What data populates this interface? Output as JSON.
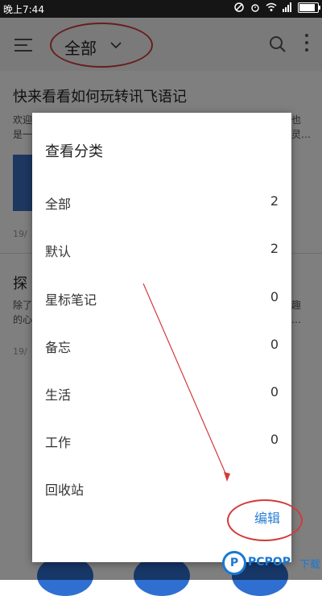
{
  "status_bar": {
    "time": "晚上7:44"
  },
  "header": {
    "title": "全部"
  },
  "notes": [
    {
      "title": "快来看看如何玩转讯飞语记",
      "snippet_left": [
        "欢迎",
        "是一"
      ],
      "snippet_right": [
        "也",
        "灵…"
      ],
      "date": "19/"
    },
    {
      "title": "探",
      "snippet_left": [
        "除了",
        "的心"
      ],
      "snippet_right": [
        "趣",
        "…"
      ],
      "date": "19/"
    }
  ],
  "dialog": {
    "title": "查看分类",
    "categories": [
      {
        "label": "全部",
        "count": "2"
      },
      {
        "label": "默认",
        "count": "2"
      },
      {
        "label": "星标笔记",
        "count": "0"
      },
      {
        "label": "备忘",
        "count": "0"
      },
      {
        "label": "生活",
        "count": "0"
      },
      {
        "label": "工作",
        "count": "0"
      },
      {
        "label": "回收站",
        "count": ""
      }
    ],
    "edit_label": "编辑"
  },
  "watermark": {
    "logo": "P",
    "text": "PCPOP",
    "sub": "下载"
  },
  "colors": {
    "accent": "#2a7fd4",
    "annotation": "#d23a3a",
    "fab": "#2f6fd1"
  }
}
